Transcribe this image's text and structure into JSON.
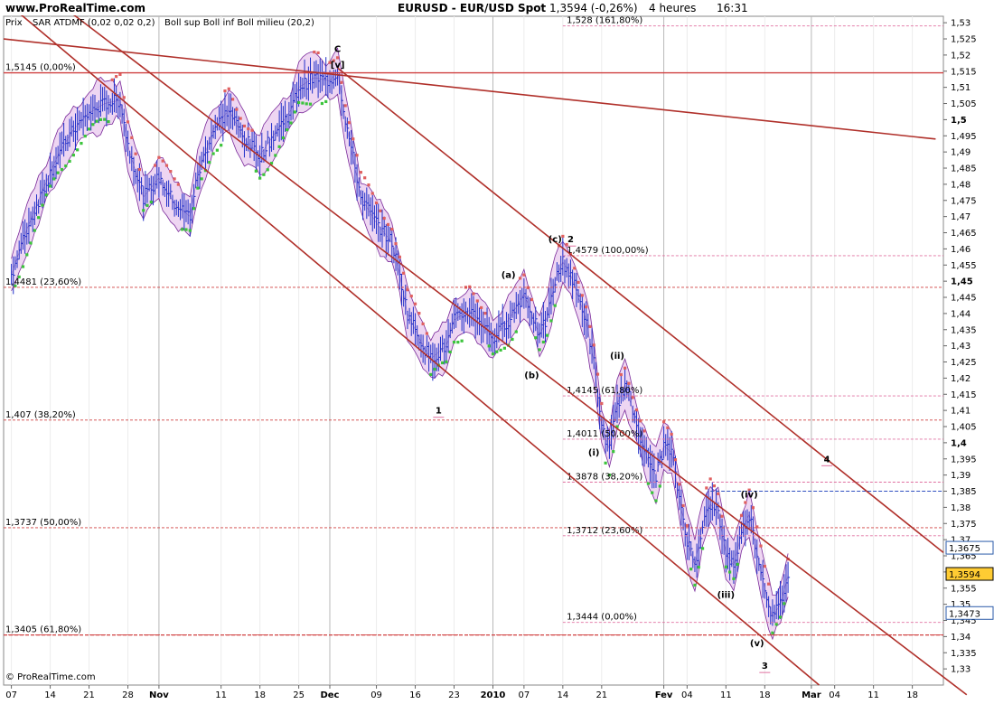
{
  "header": {
    "site": "www.ProRealTime.com",
    "instrument": "EURUSD - EUR/USD Spot",
    "last": "1,3594 (-0,26%)",
    "timeframe": "4 heures",
    "time": "16:31"
  },
  "legend": {
    "prix": "Prix",
    "sar": "SAR ATDMF (0,02 0,02 0,2)",
    "boll": "Boll sup Boll inf Boll milieu (20,2)"
  },
  "footer": {
    "copyright": "© ProRealTime.com"
  },
  "colors": {
    "bars": "#1f2fc8",
    "sar_up": "#3cc43c",
    "sar_down": "#e06060",
    "band_fill": "#e8c8ee",
    "band_line": "#7a2a9a",
    "trend": "#b0302a",
    "fib": "#d04040",
    "pink": "#e070a0",
    "blue_label": "#5a8ad8",
    "red_label": "#c03030",
    "green_label": "#3a9a3a"
  },
  "chart_data": {
    "type": "line",
    "title": "EURUSD - EUR/USD Spot",
    "ylim": [
      1.325,
      1.532
    ],
    "y_ticks": [
      "1,53",
      "1,525",
      "1,52",
      "1,515",
      "1,51",
      "1,505",
      "1,5",
      "1,495",
      "1,49",
      "1,485",
      "1,48",
      "1,475",
      "1,47",
      "1,465",
      "1,46",
      "1,455",
      "1,45",
      "1,445",
      "1,44",
      "1,435",
      "1,43",
      "1,425",
      "1,42",
      "1,415",
      "1,41",
      "1,405",
      "1,4",
      "1,395",
      "1,39",
      "1,385",
      "1,38",
      "1,375",
      "1,37",
      "1,365",
      "1,36",
      "1,355",
      "1,35",
      "1,345",
      "1,34",
      "1,335",
      "1,33"
    ],
    "y_bold_ticks": [
      "1,5",
      "1,45",
      "1,4"
    ],
    "x_ticks": [
      {
        "label": "07",
        "t": 0
      },
      {
        "label": "14",
        "t": 5
      },
      {
        "label": "21",
        "t": 10
      },
      {
        "label": "28",
        "t": 15
      },
      {
        "label": "Nov",
        "t": 19,
        "bold": true
      },
      {
        "label": "11",
        "t": 27
      },
      {
        "label": "18",
        "t": 32
      },
      {
        "label": "25",
        "t": 37
      },
      {
        "label": "Dec",
        "t": 41,
        "bold": true
      },
      {
        "label": "09",
        "t": 47
      },
      {
        "label": "16",
        "t": 52
      },
      {
        "label": "23",
        "t": 57
      },
      {
        "label": "2010",
        "t": 62,
        "bold": true
      },
      {
        "label": "07",
        "t": 66
      },
      {
        "label": "14",
        "t": 71
      },
      {
        "label": "21",
        "t": 76
      },
      {
        "label": "Fev",
        "t": 84,
        "bold": true
      },
      {
        "label": "04",
        "t": 87
      },
      {
        "label": "11",
        "t": 92
      },
      {
        "label": "18",
        "t": 97
      },
      {
        "label": "Mar",
        "t": 103,
        "bold": true
      },
      {
        "label": "04",
        "t": 106
      },
      {
        "label": "11",
        "t": 111
      },
      {
        "label": "18",
        "t": 116
      }
    ],
    "x_range": [
      -1,
      120
    ],
    "price_path": [
      [
        0,
        1.452
      ],
      [
        2,
        1.466
      ],
      [
        4,
        1.478
      ],
      [
        6,
        1.489
      ],
      [
        8,
        1.497
      ],
      [
        10,
        1.502
      ],
      [
        12,
        1.505
      ],
      [
        14,
        1.506
      ],
      [
        15,
        1.492
      ],
      [
        17,
        1.476
      ],
      [
        19,
        1.482
      ],
      [
        21,
        1.474
      ],
      [
        23,
        1.47
      ],
      [
        24,
        1.483
      ],
      [
        26,
        1.497
      ],
      [
        28,
        1.503
      ],
      [
        30,
        1.494
      ],
      [
        32,
        1.489
      ],
      [
        34,
        1.496
      ],
      [
        36,
        1.503
      ],
      [
        37,
        1.51
      ],
      [
        39,
        1.513
      ],
      [
        41,
        1.512
      ],
      [
        42,
        1.515
      ],
      [
        43,
        1.5
      ],
      [
        44,
        1.488
      ],
      [
        45,
        1.476
      ],
      [
        47,
        1.468
      ],
      [
        49,
        1.462
      ],
      [
        50,
        1.452
      ],
      [
        51,
        1.44
      ],
      [
        53,
        1.43
      ],
      [
        54,
        1.426
      ],
      [
        56,
        1.43
      ],
      [
        57,
        1.438
      ],
      [
        59,
        1.441
      ],
      [
        61,
        1.436
      ],
      [
        62,
        1.432
      ],
      [
        64,
        1.438
      ],
      [
        66,
        1.446
      ],
      [
        67,
        1.44
      ],
      [
        68,
        1.433
      ],
      [
        69,
        1.439
      ],
      [
        70,
        1.45
      ],
      [
        71,
        1.456
      ],
      [
        72,
        1.452
      ],
      [
        73,
        1.445
      ],
      [
        74,
        1.438
      ],
      [
        75,
        1.425
      ],
      [
        76,
        1.405
      ],
      [
        77,
        1.398
      ],
      [
        78,
        1.412
      ],
      [
        79,
        1.418
      ],
      [
        80,
        1.41
      ],
      [
        81,
        1.402
      ],
      [
        82,
        1.394
      ],
      [
        83,
        1.39
      ],
      [
        84,
        1.399
      ],
      [
        85,
        1.397
      ],
      [
        86,
        1.383
      ],
      [
        87,
        1.37
      ],
      [
        88,
        1.362
      ],
      [
        89,
        1.375
      ],
      [
        90,
        1.381
      ],
      [
        91,
        1.378
      ],
      [
        92,
        1.366
      ],
      [
        93,
        1.362
      ],
      [
        94,
        1.372
      ],
      [
        95,
        1.378
      ],
      [
        96,
        1.366
      ],
      [
        97,
        1.355
      ],
      [
        98,
        1.346
      ],
      [
        99,
        1.35
      ],
      [
        100,
        1.359
      ]
    ],
    "trendlines": [
      {
        "from": [
          -1,
          1.525
        ],
        "to": [
          119,
          1.494
        ]
      },
      {
        "from": [
          5,
          1.538
        ],
        "to": [
          123,
          1.322
        ]
      },
      {
        "from": [
          42,
          1.516
        ],
        "to": [
          120,
          1.366
        ]
      },
      {
        "from": [
          0,
          1.535
        ],
        "to": [
          104,
          1.325
        ]
      }
    ],
    "fib_left": [
      {
        "label": "1,5145 (0,00%)",
        "y": 1.5145
      },
      {
        "label": "1,4481 (23,60%)",
        "y": 1.4481
      },
      {
        "label": "1,407 (38,20%)",
        "y": 1.407
      },
      {
        "label": "1,3737 (50,00%)",
        "y": 1.3737
      },
      {
        "label": "1,3405 (61,80%)",
        "y": 1.3405
      }
    ],
    "fib_right": [
      {
        "label": "1,528 (161,80%)",
        "y": 1.529
      },
      {
        "label": "1,4579 (100,00%)",
        "y": 1.4579
      },
      {
        "label": "1,4145 (61,80%)",
        "y": 1.4145
      },
      {
        "label": "1,4011 (50,00%)",
        "y": 1.4011
      },
      {
        "label": "1,3878 (38,20%)",
        "y": 1.3878
      },
      {
        "label": "1,3712 (23,60%)",
        "y": 1.3712
      },
      {
        "label": "1,3444 (0,00%)",
        "y": 1.3444
      }
    ],
    "wave_labels": [
      {
        "text": "C",
        "t": 42,
        "y": 1.521,
        "color": "green",
        "size": 14
      },
      {
        "text": "[v]",
        "t": 42,
        "y": 1.516,
        "color": "green",
        "size": 12
      },
      {
        "text": "(c)",
        "t": 70,
        "y": 1.462,
        "color": "blue",
        "size": 10
      },
      {
        "text": "2",
        "t": 72,
        "y": 1.462,
        "color": "pink",
        "size": 14
      },
      {
        "text": "(a)",
        "t": 64,
        "y": 1.451,
        "color": "blue",
        "size": 10
      },
      {
        "text": "(b)",
        "t": 67,
        "y": 1.42,
        "color": "blue",
        "size": 10
      },
      {
        "text": "1",
        "t": 55,
        "y": 1.409,
        "color": "pink",
        "size": 14
      },
      {
        "text": "(ii)",
        "t": 78,
        "y": 1.426,
        "color": "red",
        "size": 10
      },
      {
        "text": "(i)",
        "t": 75,
        "y": 1.396,
        "color": "red",
        "size": 10
      },
      {
        "text": "(iv)",
        "t": 95,
        "y": 1.383,
        "color": "red",
        "size": 10
      },
      {
        "text": "(iii)",
        "t": 92,
        "y": 1.352,
        "color": "red",
        "size": 10
      },
      {
        "text": "(v)",
        "t": 96,
        "y": 1.337,
        "color": "red",
        "size": 10
      },
      {
        "text": "3",
        "t": 97,
        "y": 1.33,
        "color": "pink",
        "size": 14
      },
      {
        "text": "4",
        "t": 105,
        "y": 1.394,
        "color": "pink",
        "size": 14
      }
    ],
    "axis_badges": [
      {
        "text": "1,3675",
        "y": 1.3675,
        "bg": "#ffffff",
        "border": "#2a5aa8"
      },
      {
        "text": "1,3594",
        "y": 1.3594,
        "bg": "#ffcc33",
        "border": "#000000"
      },
      {
        "text": "1,3473",
        "y": 1.3473,
        "bg": "#ffffff",
        "border": "#2a5aa8"
      }
    ]
  }
}
